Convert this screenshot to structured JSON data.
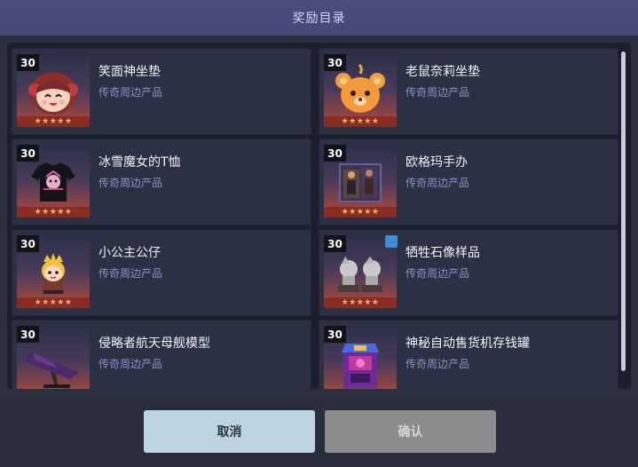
{
  "dialog": {
    "title": "奖励目录"
  },
  "items": [
    {
      "qty": "30",
      "name": "笑面神坐垫",
      "category": "传奇周边产品",
      "stars": "★★★★★",
      "icon": "smiling-girl-cushion-icon"
    },
    {
      "qty": "30",
      "name": "老鼠奈莉坐垫",
      "category": "传奇周边产品",
      "stars": "★★★★★",
      "icon": "mouse-nelly-cushion-icon"
    },
    {
      "qty": "30",
      "name": "冰雪魔女的T恤",
      "category": "传奇周边产品",
      "stars": "★★★★★",
      "icon": "t-shirt-icon"
    },
    {
      "qty": "30",
      "name": "欧格玛手办",
      "category": "传奇周边产品",
      "stars": "★★★★★",
      "icon": "figure-box-icon"
    },
    {
      "qty": "30",
      "name": "小公主公仔",
      "category": "传奇周边产品",
      "stars": "★★★★★",
      "icon": "princess-doll-icon"
    },
    {
      "qty": "30",
      "name": "牺牲石像样品",
      "category": "传奇周边产品",
      "stars": "★★★★★",
      "icon": "stone-statue-icon"
    },
    {
      "qty": "30",
      "name": "侵略者航天母舰模型",
      "category": "传奇周边产品",
      "stars": "",
      "icon": "mothership-model-icon"
    },
    {
      "qty": "30",
      "name": "神秘自动售货机存钱罐",
      "category": "传奇周边产品",
      "stars": "",
      "icon": "vending-machine-bank-icon"
    }
  ],
  "buttons": {
    "cancel": "取消",
    "confirm": "确认"
  }
}
